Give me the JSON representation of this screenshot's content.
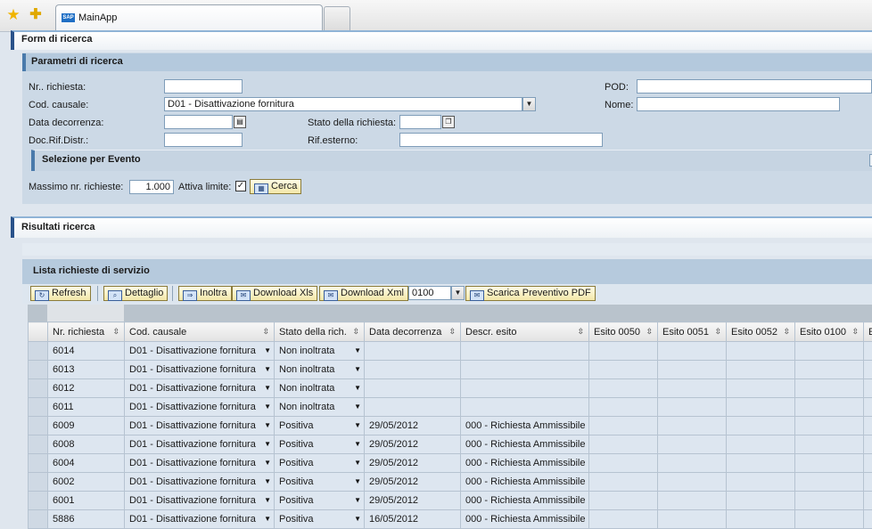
{
  "browser": {
    "tab_title": "MainApp",
    "sap_logo": "SAP"
  },
  "search_form": {
    "title": "Form di ricerca",
    "params": {
      "title": "Parametri di ricerca",
      "nr_richiesta": {
        "label": "Nr.. richiesta:",
        "value": ""
      },
      "cod_causale": {
        "label": "Cod. causale:",
        "value": "D01 - Disattivazione fornitura"
      },
      "data_decorrenza": {
        "label": "Data decorrenza:",
        "value": ""
      },
      "doc_rif": {
        "label": "Doc.Rif.Distr.:",
        "value": ""
      },
      "stato_richiesta": {
        "label": "Stato della richiesta:",
        "value": ""
      },
      "rif_esterno": {
        "label": "Rif.esterno:",
        "value": ""
      },
      "pod": {
        "label": "POD:",
        "value": ""
      },
      "nome": {
        "label": "Nome:",
        "value": ""
      }
    },
    "event_selection": {
      "title": "Selezione per Evento"
    },
    "massimo": {
      "label": "Massimo nr. richieste:",
      "value": "1.000"
    },
    "attiva_limite": {
      "label": "Attiva limite:",
      "checked": true
    },
    "cerca_label": "Cerca"
  },
  "results": {
    "title": "Risultati ricerca",
    "list_title": "Lista richieste di servizio",
    "toolbar": {
      "refresh": "Refresh",
      "dettaglio": "Dettaglio",
      "inoltra": "Inoltra",
      "download_xls": "Download Xls",
      "download_xml": "Download Xml",
      "select_value": "0100",
      "scarica": "Scarica Preventivo PDF"
    },
    "columns": [
      "Nr. richiesta",
      "Cod. causale",
      "Stato della rich.",
      "Data decorrenza",
      "Descr. esito",
      "Esito 0050",
      "Esito 0051",
      "Esito 0052",
      "Esito 0100",
      "E"
    ],
    "rows": [
      [
        "6014",
        "D01 - Disattivazione fornitura",
        "Non inoltrata",
        "",
        ""
      ],
      [
        "6013",
        "D01 - Disattivazione fornitura",
        "Non inoltrata",
        "",
        ""
      ],
      [
        "6012",
        "D01 - Disattivazione fornitura",
        "Non inoltrata",
        "",
        ""
      ],
      [
        "6011",
        "D01 - Disattivazione fornitura",
        "Non inoltrata",
        "",
        ""
      ],
      [
        "6009",
        "D01 - Disattivazione fornitura",
        "Positiva",
        "29/05/2012",
        "000 - Richiesta Ammissibile"
      ],
      [
        "6008",
        "D01 - Disattivazione fornitura",
        "Positiva",
        "29/05/2012",
        "000 - Richiesta Ammissibile"
      ],
      [
        "6004",
        "D01 - Disattivazione fornitura",
        "Positiva",
        "29/05/2012",
        "000 - Richiesta Ammissibile"
      ],
      [
        "6002",
        "D01 - Disattivazione fornitura",
        "Positiva",
        "29/05/2012",
        "000 - Richiesta Ammissibile"
      ],
      [
        "6001",
        "D01 - Disattivazione fornitura",
        "Positiva",
        "29/05/2012",
        "000 - Richiesta Ammissibile"
      ],
      [
        "5886",
        "D01 - Disattivazione fornitura",
        "Positiva",
        "16/05/2012",
        "000 - Richiesta Ammissibile"
      ]
    ]
  }
}
